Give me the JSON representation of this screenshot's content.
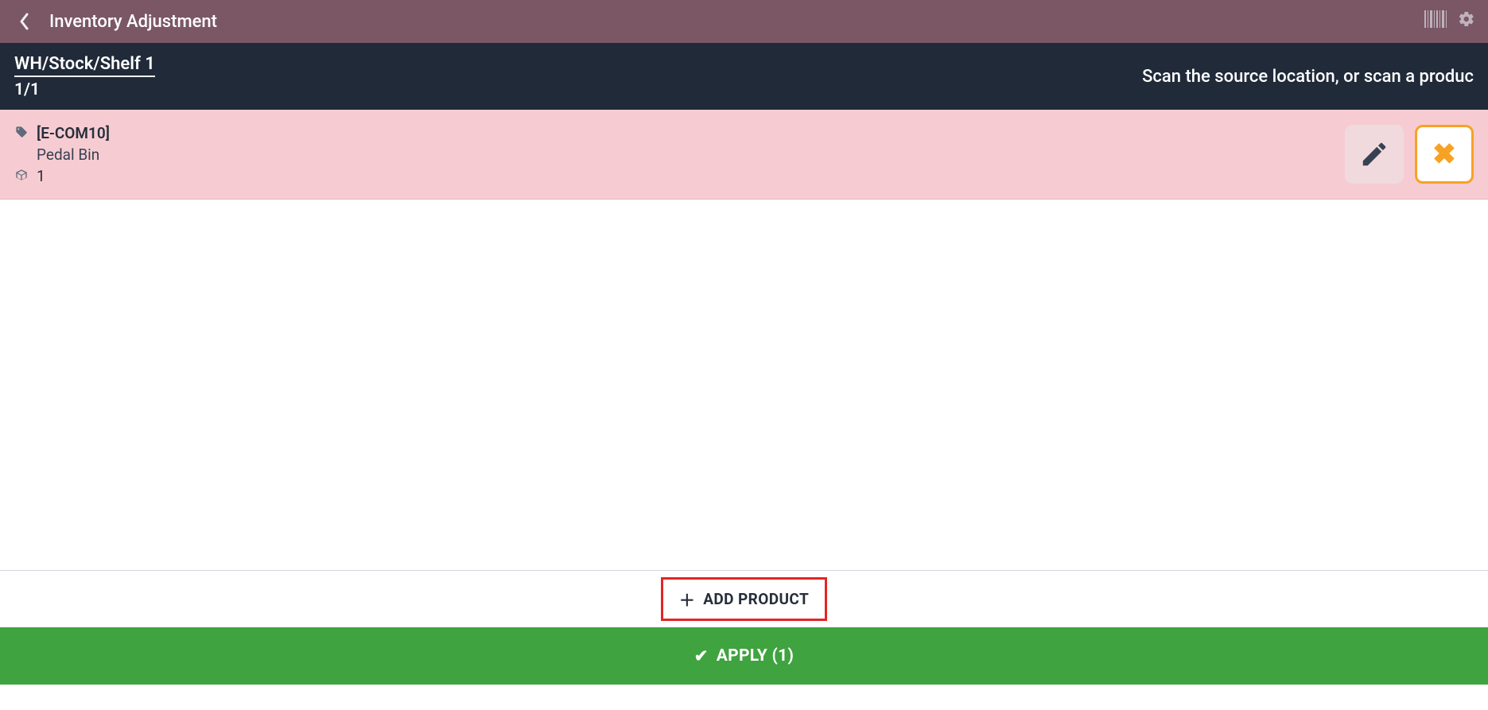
{
  "header": {
    "title": "Inventory Adjustment"
  },
  "subheader": {
    "location_path": "WH/Stock/Shelf 1",
    "counter": "1/1",
    "scan_hint": "Scan the source location, or scan a produc"
  },
  "product": {
    "reference": "[E-COM10]",
    "name": "Pedal Bin",
    "quantity": "1"
  },
  "actions": {
    "add_product_label": "ADD PRODUCT",
    "apply_label": "APPLY (1)"
  }
}
